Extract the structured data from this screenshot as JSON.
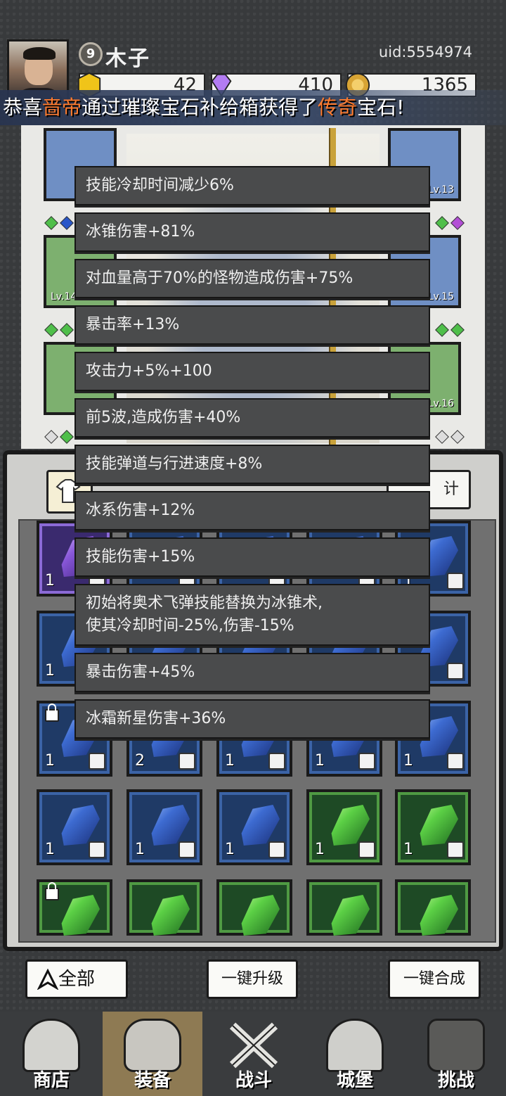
{
  "player": {
    "level": "9",
    "name": "木子",
    "uid": "uid:5554974"
  },
  "resources": {
    "gold_bar": "42",
    "diamond": "410",
    "coin": "1365"
  },
  "broadcast": {
    "prefix": "恭喜",
    "player": "啬帝",
    "middle": "通过璀璨宝石补给箱获得了",
    "rarity": "传奇",
    "suffix": "宝石!"
  },
  "equipment_slots": {
    "right_top_lv": "Lv.13",
    "left_mid_lv": "Lv.14",
    "right_mid_lv": "Lv.15",
    "right_bottom_lv": "Lv.16"
  },
  "inventory": {
    "tab_right_label": "计",
    "rows": [
      [
        "1",
        "",
        "",
        "",
        "1"
      ],
      [
        "1",
        "",
        "",
        "",
        "1"
      ],
      [
        "1",
        "2",
        "1",
        "1",
        "1"
      ],
      [
        "1",
        "1",
        "1",
        "1",
        "1"
      ],
      [
        "",
        "",
        "",
        "",
        ""
      ]
    ]
  },
  "tooltip": {
    "lines": [
      "技能冷却时间减少6%",
      "冰锥伤害+81%",
      "对血量高于70%的怪物造成伤害+75%",
      "暴击率+13%",
      "攻击力+5%+100",
      "前5波,造成伤害+40%",
      "技能弹道与行进速度+8%",
      "冰系伤害+12%",
      "技能伤害+15%",
      "初始将奥术飞弹技能替换为冰锥术,\n使其冷却时间-25%,伤害-15%",
      "暴击伤害+45%",
      "冰霜新星伤害+36%"
    ]
  },
  "buttons": {
    "all": "全部",
    "upgrade_all": "一键升级",
    "merge_all": "一键合成"
  },
  "nav": {
    "shop": "商店",
    "equipment": "装备",
    "battle": "战斗",
    "castle": "城堡",
    "challenge": "挑战"
  },
  "colors": {
    "highlight": "#ff7b2e",
    "nav_active": "#8e7a53"
  }
}
